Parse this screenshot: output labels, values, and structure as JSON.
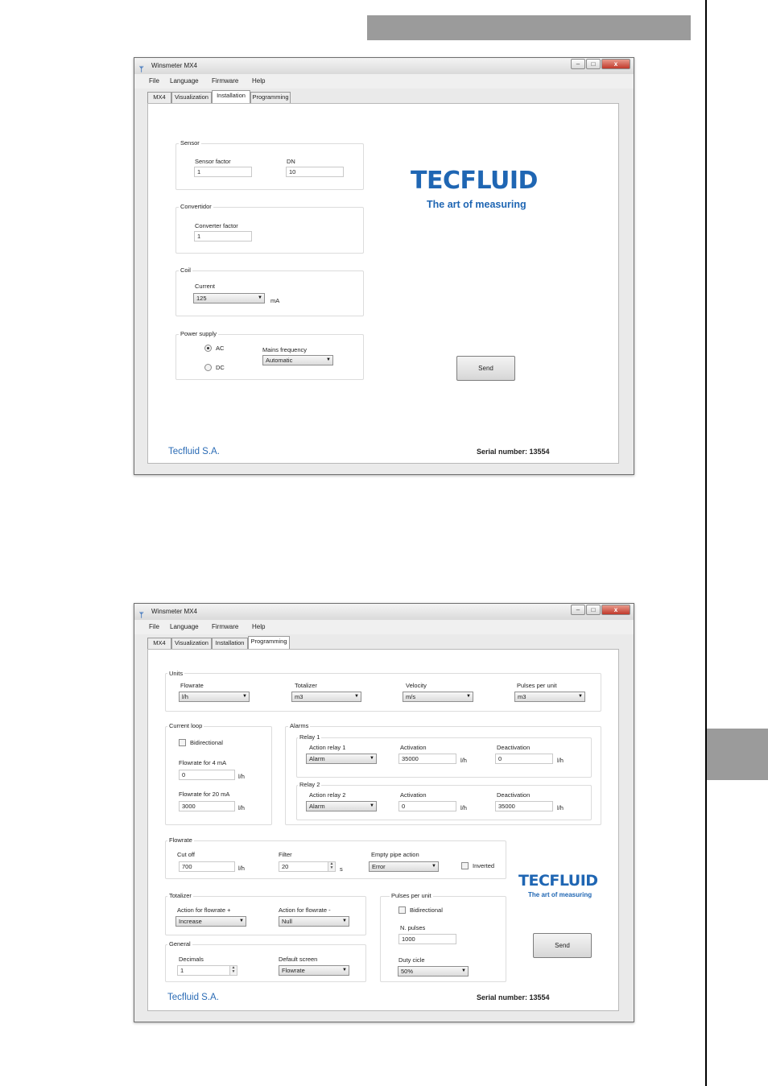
{
  "colors": {
    "accent": "#1f66b3",
    "gray_bar": "#9b9b9b",
    "window_bg": "#eaeaea"
  },
  "window1": {
    "title": "Winsmeter MX4",
    "icon": "app-logo-icon",
    "menu": [
      "File",
      "Language",
      "Firmware",
      "Help"
    ],
    "tabs": [
      "MX4",
      "Visualization",
      "Installation",
      "Programming"
    ],
    "active_tab": "Installation",
    "sensor": {
      "title": "Sensor",
      "factor_label": "Sensor factor",
      "factor_value": "1",
      "dn_label": "DN",
      "dn_value": "10"
    },
    "convertidor": {
      "title": "Convertidor",
      "factor_label": "Converter factor",
      "factor_value": "1"
    },
    "coil": {
      "title": "Coil",
      "current_label": "Current",
      "current_value": "125",
      "unit": "mA"
    },
    "power": {
      "title": "Power supply",
      "ac_label": "AC",
      "dc_label": "DC",
      "selected": "AC",
      "mains_label": "Mains frequency",
      "mains_value": "Automatic"
    },
    "logo": {
      "word": "TECFLUID",
      "tagline": "The art of measuring"
    },
    "send_label": "Send",
    "company": "Tecfluid S.A.",
    "serial": "Serial number: 13554"
  },
  "window2": {
    "title": "Winsmeter MX4",
    "icon": "app-logo-icon",
    "menu": [
      "File",
      "Language",
      "Firmware",
      "Help"
    ],
    "tabs": [
      "MX4",
      "Visualization",
      "Installation",
      "Programming"
    ],
    "active_tab": "Programming",
    "units": {
      "title": "Units",
      "flowrate_label": "Flowrate",
      "flowrate_value": "l/h",
      "totalizer_label": "Totalizer",
      "totalizer_value": "m3",
      "velocity_label": "Velocity",
      "velocity_value": "m/s",
      "pulses_label": "Pulses per unit",
      "pulses_value": "m3"
    },
    "current_loop": {
      "title": "Current loop",
      "bidirectional_label": "Bidirectional",
      "f4_label": "Flowrate for 4 mA",
      "f4_value": "0",
      "f4_unit": "l/h",
      "f20_label": "Flowrate for 20 mA",
      "f20_value": "3000",
      "f20_unit": "l/h"
    },
    "alarms": {
      "title": "Alarms",
      "relay1": {
        "title": "Relay 1",
        "action_label": "Action relay 1",
        "action_value": "Alarm",
        "act_label": "Activation",
        "act_value": "35000",
        "act_unit": "l/h",
        "deact_label": "Deactivation",
        "deact_value": "0",
        "deact_unit": "l/h"
      },
      "relay2": {
        "title": "Relay 2",
        "action_label": "Action relay 2",
        "action_value": "Alarm",
        "act_label": "Activation",
        "act_value": "0",
        "act_unit": "l/h",
        "deact_label": "Deactivation",
        "deact_value": "35000",
        "deact_unit": "l/h"
      }
    },
    "flowrate": {
      "title": "Flowrate",
      "cutoff_label": "Cut off",
      "cutoff_value": "700",
      "cutoff_unit": "l/h",
      "filter_label": "Filter",
      "filter_value": "20",
      "filter_unit": "s",
      "empty_label": "Empty pipe action",
      "empty_value": "Error",
      "inverted_label": "Inverted"
    },
    "totalizer": {
      "title": "Totalizer",
      "plus_label": "Action for flowrate +",
      "plus_value": "Increase",
      "minus_label": "Action for flowrate -",
      "minus_value": "Null"
    },
    "general": {
      "title": "General",
      "decimals_label": "Decimals",
      "decimals_value": "1",
      "screen_label": "Default screen",
      "screen_value": "Flowrate"
    },
    "pulses": {
      "title": "Pulses per unit",
      "bidirectional_label": "Bidirectional",
      "npulses_label": "N. pulses",
      "npulses_value": "1000",
      "duty_label": "Duty cicle",
      "duty_value": "50%"
    },
    "logo": {
      "word": "TECFLUID",
      "tagline": "The art of measuring"
    },
    "send_label": "Send",
    "company": "Tecfluid S.A.",
    "serial": "Serial number: 13554"
  }
}
